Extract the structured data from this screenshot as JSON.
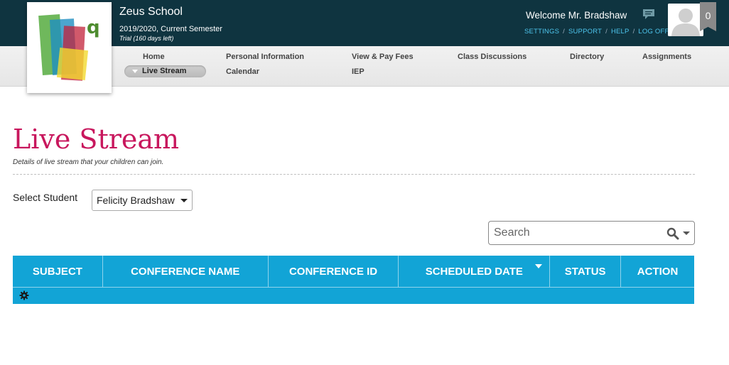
{
  "header": {
    "school_name": "Zeus School",
    "semester": "2019/2020, Current Semester",
    "trial": "Trial (160 days left)",
    "welcome": "Welcome Mr. Bradshaw",
    "links": [
      "SETTINGS",
      "SUPPORT",
      "HELP",
      "LOG OFF"
    ],
    "notification_count": "0",
    "logo_letter": "q"
  },
  "nav": {
    "home": "Home",
    "live_stream": "Live Stream",
    "personal_info": "Personal Information",
    "calendar": "Calendar",
    "view_pay_fees": "View & Pay Fees",
    "iep": "IEP",
    "class_discussions": "Class Discussions",
    "directory": "Directory",
    "assignments": "Assignments"
  },
  "page": {
    "title": "Live Stream",
    "subtitle": "Details of live stream that your children can join."
  },
  "filter": {
    "label": "Select Student",
    "selected": "Felicity Bradshaw"
  },
  "search": {
    "placeholder": "Search"
  },
  "table": {
    "columns": [
      "SUBJECT",
      "CONFERENCE NAME",
      "CONFERENCE ID",
      "SCHEDULED DATE",
      "STATUS",
      "ACTION"
    ]
  },
  "colors": {
    "topbar": "#0f3440",
    "accent_title": "#c8175d",
    "grid_header": "#12a4d6",
    "link": "#4ec6ee"
  },
  "icons": [
    "chat-icon",
    "avatar-placeholder-icon",
    "search-icon",
    "dropdown-caret-icon",
    "sort-down-icon",
    "gear-icon"
  ]
}
